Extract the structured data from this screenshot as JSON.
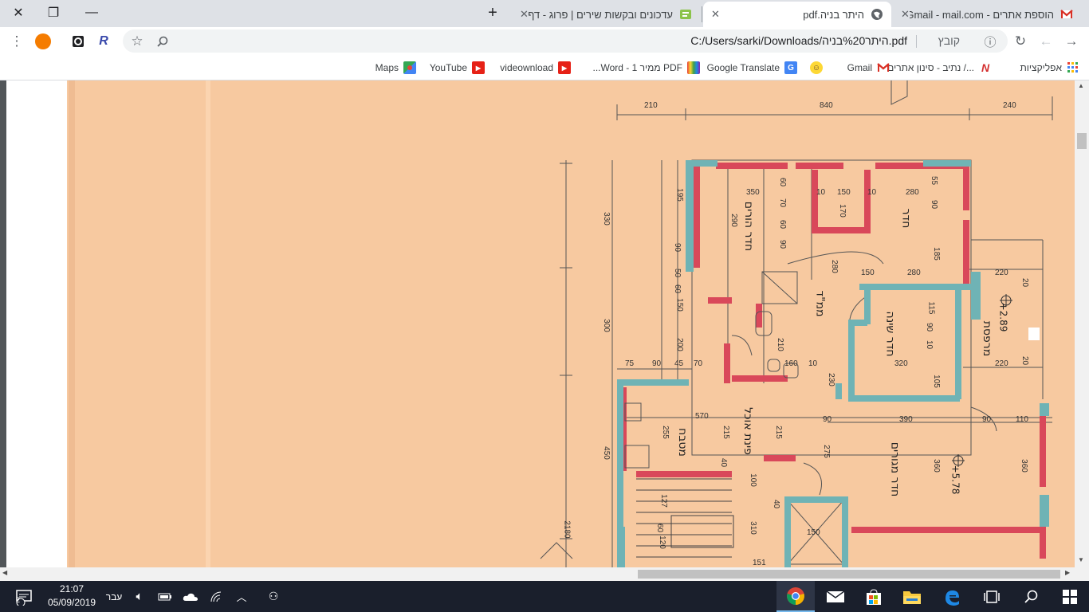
{
  "window": {
    "minimize": "—",
    "restore": "❐",
    "close": "✕"
  },
  "tabs": [
    {
      "title": "הוספת אתרים - Gmail - mail.com",
      "favicon": "gmail-icon",
      "active": false
    },
    {
      "title": "היתר בניה.pdf",
      "favicon": "globe-icon",
      "active": true
    },
    {
      "title": "עדכונים ובקשות שירים | פרוג - דף",
      "favicon": "site-icon",
      "active": false
    }
  ],
  "new_tab": "+",
  "toolbar": {
    "file_label": "קובץ",
    "url": "C:/Users/sarki/Downloads/היתר%20בניה.pdf"
  },
  "bookmarks": [
    {
      "label": "אפליקציות",
      "icon": "apps-grid-icon"
    },
    {
      "label": "נתיב - סינון אתרים /...",
      "icon": "netiv-icon"
    },
    {
      "label": "Gmail",
      "icon": "gmail-icon"
    },
    {
      "label": "",
      "icon": "emoji-icon"
    },
    {
      "label": "Google Translate",
      "icon": "translate-icon"
    },
    {
      "label": "PDF ממיר Word - 1...",
      "icon": "colorful-icon"
    },
    {
      "label": "videownload",
      "icon": "youtube-icon"
    },
    {
      "label": "YouTube",
      "icon": "youtube-icon"
    },
    {
      "label": "Maps",
      "icon": "maps-icon"
    }
  ],
  "plan": {
    "dims_top": [
      "210",
      "840",
      "240"
    ],
    "dims_left": [
      "330",
      "300",
      "450",
      "2180",
      "195",
      "90",
      "50",
      "60",
      "150",
      "200",
      "75",
      "90",
      "45",
      "70"
    ],
    "dims_inner": [
      "350",
      "290",
      "60",
      "70",
      "60",
      "90",
      "10",
      "150",
      "10",
      "280",
      "55",
      "90",
      "185",
      "170",
      "280",
      "150",
      "280",
      "115",
      "90",
      "10",
      "320",
      "105",
      "220",
      "220",
      "20",
      "20",
      "570",
      "390",
      "90",
      "90",
      "110",
      "255",
      "215",
      "215",
      "275",
      "360",
      "360",
      "127",
      "40",
      "100",
      "40",
      "310",
      "120",
      "60",
      "150",
      "151",
      "160",
      "210",
      "230",
      "10"
    ],
    "rooms": [
      {
        "label": "חדר הורים"
      },
      {
        "label": "חדר"
      },
      {
        "label": "חדר שינה"
      },
      {
        "label": "חדר מגורים"
      },
      {
        "label": "פינת אוכל"
      },
      {
        "label": "מטבח"
      },
      {
        "label": "מרפסת"
      },
      {
        "label": "ממ\"ד"
      }
    ],
    "levels": [
      "+2.89",
      "+5.78"
    ]
  },
  "taskbar": {
    "time": "21:07",
    "date": "05/09/2019",
    "lang": "עבר",
    "notification_count": "2"
  }
}
